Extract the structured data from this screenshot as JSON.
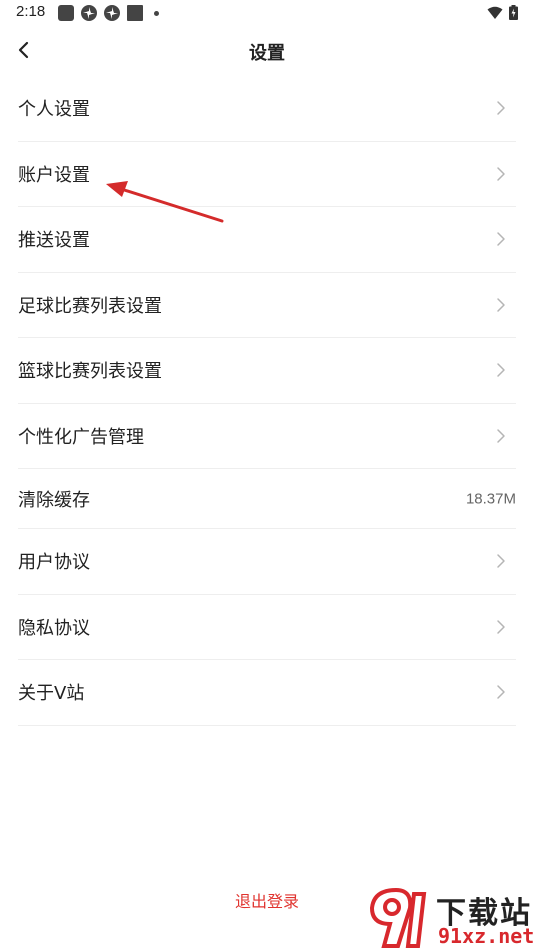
{
  "status_bar": {
    "time": "2:18"
  },
  "nav": {
    "title": "设置"
  },
  "settings": {
    "items": [
      {
        "label": "个人设置",
        "accessory": "chevron"
      },
      {
        "label": "账户设置",
        "accessory": "chevron"
      },
      {
        "label": "推送设置",
        "accessory": "chevron"
      },
      {
        "label": "足球比赛列表设置",
        "accessory": "chevron"
      },
      {
        "label": "篮球比赛列表设置",
        "accessory": "chevron"
      },
      {
        "label": "个性化广告管理",
        "accessory": "chevron"
      },
      {
        "label": "清除缓存",
        "accessory": "value",
        "value": "18.37M"
      },
      {
        "label": "用户协议",
        "accessory": "chevron"
      },
      {
        "label": "隐私协议",
        "accessory": "chevron"
      },
      {
        "label": "关于V站",
        "accessory": "chevron"
      }
    ]
  },
  "logout": {
    "label": "退出登录"
  },
  "watermark": {
    "logo_text": "下载站",
    "domain": "91xz.net"
  },
  "colors": {
    "accent_red": "#e0342f",
    "divider": "#eeeeee",
    "text_primary": "#222222",
    "text_secondary": "#666666",
    "chevron": "#b5b5b5",
    "annotation_arrow": "#d42b2b"
  },
  "icons": {
    "back": "chevron-left-icon",
    "row_accessory": "chevron-right-icon"
  }
}
